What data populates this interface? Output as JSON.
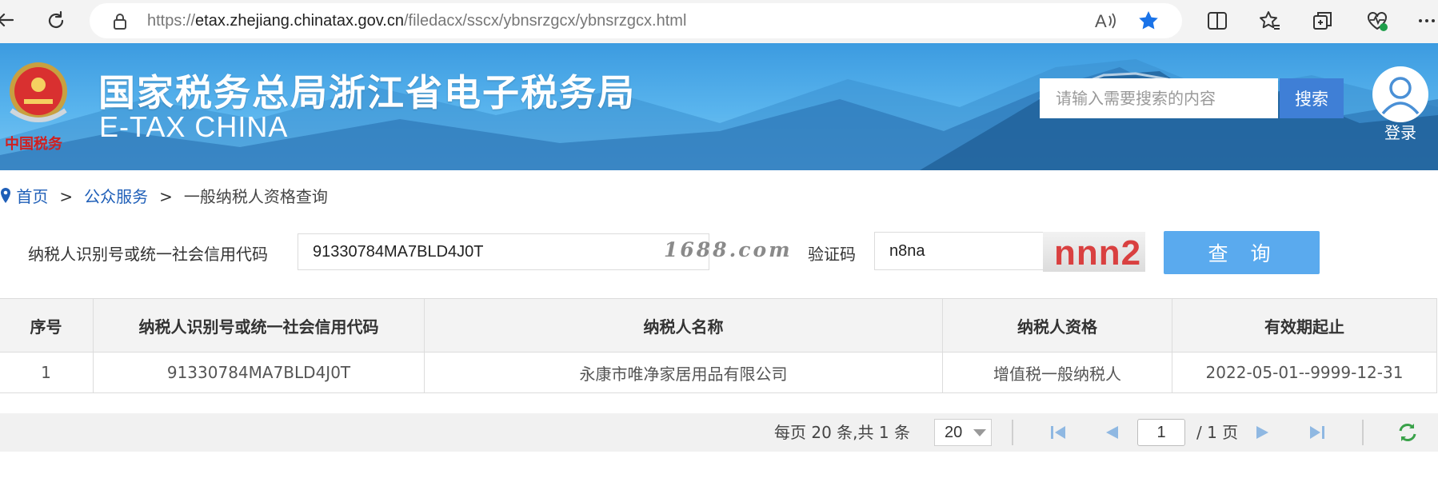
{
  "browser": {
    "url_prefix": "https://",
    "url_host": "etax.zhejiang.chinatax.gov.cn",
    "url_path": "/filedacx/sscx/ybnsrzgcx/ybnsrzgcx.html",
    "favorite_color": "#1a73e8"
  },
  "header": {
    "title": "国家税务总局浙江省电子税务局",
    "subtitle": "E-TAX CHINA",
    "emblem_text": "中国税务",
    "search_placeholder": "请输入需要搜索的内容",
    "search_button": "搜索",
    "login_label": "登录"
  },
  "breadcrumb": {
    "home": "首页",
    "separator": ">",
    "section": "公众服务",
    "current": "一般纳税人资格查询"
  },
  "query": {
    "tax_id_label": "纳税人识别号或统一社会信用代码",
    "tax_id_value": "91330784MA7BLD4J0T",
    "watermark": "1688.com",
    "captcha_label": "验证码",
    "captcha_value": "n8na",
    "captcha_image_text": "nnn2",
    "submit_button": "查 询"
  },
  "table": {
    "columns": [
      "序号",
      "纳税人识别号或统一社会信用代码",
      "纳税人名称",
      "纳税人资格",
      "有效期起止"
    ],
    "rows": [
      [
        "1",
        "91330784MA7BLD4J0T",
        "永康市唯净家居用品有限公司",
        "增值税一般纳税人",
        "2022-05-01--9999-12-31"
      ]
    ]
  },
  "pager": {
    "summary": "每页 20 条,共 1 条",
    "page_size": "20",
    "current_page": "1",
    "total_pages": "/ 1 页"
  },
  "colors": {
    "accent": "#5aaaee",
    "link": "#1f5fb8",
    "search_button": "#3f7fd6"
  }
}
